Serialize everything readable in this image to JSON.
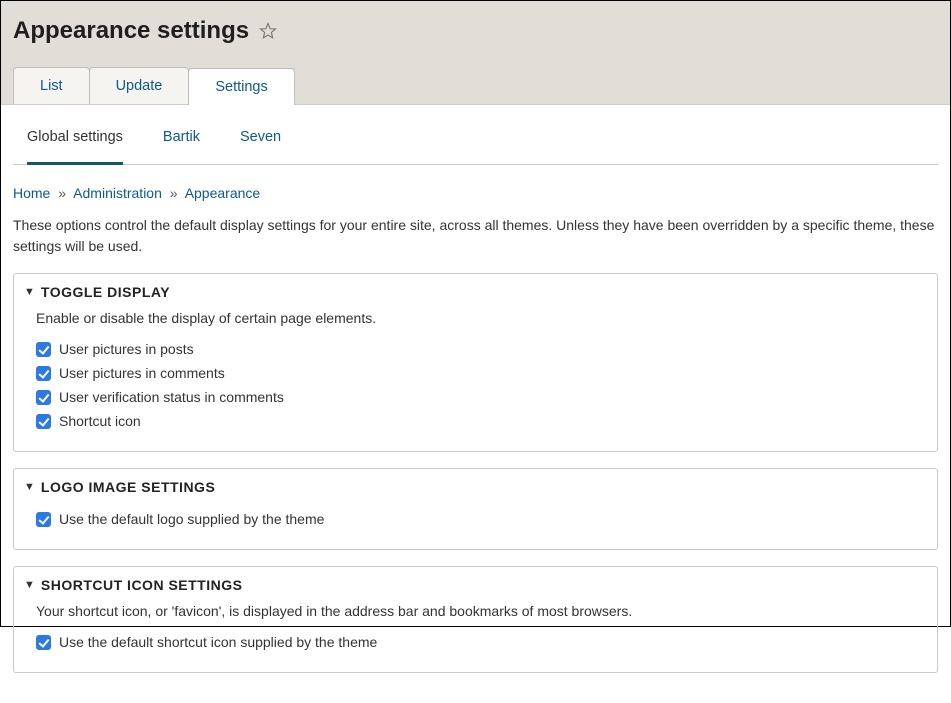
{
  "page_title": "Appearance settings",
  "primary_tabs": {
    "list": "List",
    "update": "Update",
    "settings": "Settings"
  },
  "secondary_tabs": {
    "global": "Global settings",
    "bartik": "Bartik",
    "seven": "Seven"
  },
  "breadcrumb": {
    "home": "Home",
    "admin": "Administration",
    "appearance": "Appearance",
    "sep": "»"
  },
  "intro": "These options control the default display settings for your entire site, across all themes. Unless they have been overridden by a specific theme, these settings will be used.",
  "toggle_display": {
    "title": "TOGGLE DISPLAY",
    "desc": "Enable or disable the display of certain page elements.",
    "items": [
      "User pictures in posts",
      "User pictures in comments",
      "User verification status in comments",
      "Shortcut icon"
    ]
  },
  "logo_settings": {
    "title": "LOGO IMAGE SETTINGS",
    "checkbox": "Use the default logo supplied by the theme"
  },
  "shortcut_settings": {
    "title": "SHORTCUT ICON SETTINGS",
    "desc": "Your shortcut icon, or 'favicon', is displayed in the address bar and bookmarks of most browsers.",
    "checkbox": "Use the default shortcut icon supplied by the theme"
  }
}
